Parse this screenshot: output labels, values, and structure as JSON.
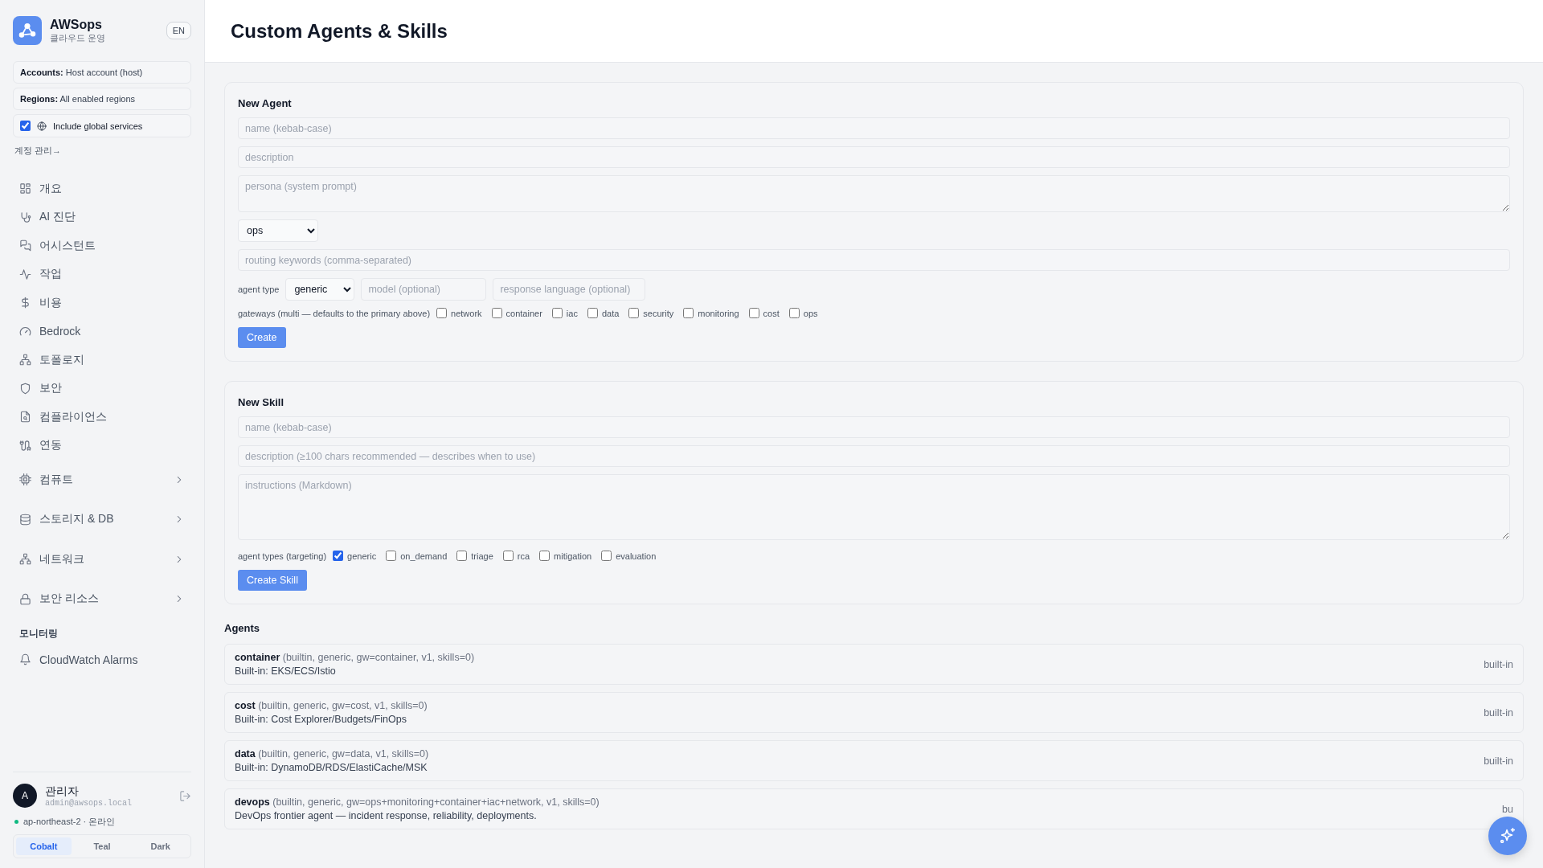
{
  "sidebar": {
    "brand": {
      "name": "AWSops",
      "subtitle": "클라우드 운영"
    },
    "language_button": "EN",
    "accounts": {
      "label": "Accounts:",
      "value": "Host account (host)"
    },
    "regions": {
      "label": "Regions:",
      "value": "All enabled regions"
    },
    "global_services": {
      "label": "Include global services",
      "checked": true
    },
    "account_link": "계정 관리→",
    "nav": [
      {
        "label": "개요",
        "kind": "link"
      },
      {
        "label": "AI 진단",
        "kind": "link"
      },
      {
        "label": "어시스턴트",
        "kind": "link"
      },
      {
        "label": "작업",
        "kind": "link"
      },
      {
        "label": "비용",
        "kind": "link"
      },
      {
        "label": "Bedrock",
        "kind": "link"
      },
      {
        "label": "토폴로지",
        "kind": "link"
      },
      {
        "label": "보안",
        "kind": "link"
      },
      {
        "label": "컴플라이언스",
        "kind": "link"
      },
      {
        "label": "연동",
        "kind": "link"
      },
      {
        "label": "컴퓨트",
        "kind": "group"
      },
      {
        "label": "스토리지 & DB",
        "kind": "group"
      },
      {
        "label": "네트워크",
        "kind": "group"
      },
      {
        "label": "보안 리소스",
        "kind": "group"
      }
    ],
    "section_label": "모니터링",
    "monitoring_nav": [
      {
        "label": "CloudWatch Alarms"
      }
    ],
    "user": {
      "avatar": "A",
      "name": "관리자",
      "email": "admin@awsops.local"
    },
    "status": {
      "text": "ap-northeast-2 · 온라인",
      "online": true
    },
    "themes": [
      {
        "label": "Cobalt",
        "selected": true
      },
      {
        "label": "Teal",
        "selected": false
      },
      {
        "label": "Dark",
        "selected": false
      }
    ]
  },
  "page": {
    "title": "Custom Agents & Skills"
  },
  "new_agent": {
    "title": "New Agent",
    "fields": [
      {
        "kind": "input",
        "placeholder": "name (kebab-case)"
      },
      {
        "kind": "input",
        "placeholder": "description"
      },
      {
        "kind": "textarea",
        "placeholder": "persona (system prompt)"
      },
      {
        "kind": "select",
        "value": "ops"
      },
      {
        "kind": "input",
        "placeholder": "routing keywords (comma-separated)"
      }
    ],
    "agent_type": {
      "label": "agent type",
      "value": "generic"
    },
    "model": {
      "placeholder": "model (optional)"
    },
    "response_language": {
      "placeholder": "response language (optional)"
    },
    "gateways": {
      "label": "gateways (multi — defaults to the primary above)",
      "options": [
        {
          "label": "network",
          "checked": false
        },
        {
          "label": "container",
          "checked": false
        },
        {
          "label": "iac",
          "checked": false
        },
        {
          "label": "data",
          "checked": false
        },
        {
          "label": "security",
          "checked": false
        },
        {
          "label": "monitoring",
          "checked": false
        },
        {
          "label": "cost",
          "checked": false
        },
        {
          "label": "ops",
          "checked": false
        }
      ]
    },
    "button": "Create"
  },
  "new_skill": {
    "title": "New Skill",
    "fields": [
      {
        "kind": "input",
        "placeholder": "name (kebab-case)"
      },
      {
        "kind": "input",
        "placeholder": "description (≥100 chars recommended — describes when to use)"
      },
      {
        "kind": "textarea",
        "placeholder": "instructions (Markdown)"
      }
    ],
    "agent_types": {
      "label": "agent types (targeting)",
      "options": [
        {
          "label": "generic",
          "checked": true
        },
        {
          "label": "on_demand",
          "checked": false
        },
        {
          "label": "triage",
          "checked": false
        },
        {
          "label": "rca",
          "checked": false
        },
        {
          "label": "mitigation",
          "checked": false
        },
        {
          "label": "evaluation",
          "checked": false
        }
      ]
    },
    "button": "Create Skill"
  },
  "agents": {
    "title": "Agents",
    "items": [
      {
        "name": "container",
        "meta": "(builtin, generic, gw=container, v1, skills=0)",
        "description": "Built-in: EKS/ECS/Istio",
        "badge": "built-in"
      },
      {
        "name": "cost",
        "meta": "(builtin, generic, gw=cost, v1, skills=0)",
        "description": "Built-in: Cost Explorer/Budgets/FinOps",
        "badge": "built-in"
      },
      {
        "name": "data",
        "meta": "(builtin, generic, gw=data, v1, skills=0)",
        "description": "Built-in: DynamoDB/RDS/ElastiCache/MSK",
        "badge": "built-in"
      },
      {
        "name": "devops",
        "meta": "(builtin, generic, gw=ops+monitoring+container+iac+network, v1, skills=0)",
        "description": "DevOps frontier agent — incident response, reliability, deployments.",
        "badge": "bu"
      }
    ]
  }
}
